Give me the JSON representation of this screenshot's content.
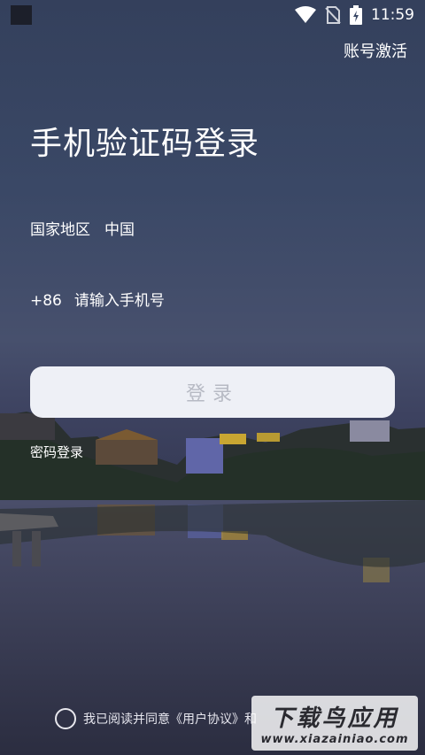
{
  "status_bar": {
    "time": "11:59",
    "icons": [
      "wifi-icon",
      "no-sim-icon",
      "battery-charging-icon"
    ]
  },
  "header": {
    "activate_label": "账号激活"
  },
  "title": "手机验证码登录",
  "region": {
    "label": "国家地区",
    "value": "中国"
  },
  "phone": {
    "country_code": "+86",
    "placeholder": "请输入手机号"
  },
  "login_button": "登录",
  "password_login_label": "密码登录",
  "agreement": {
    "text": "我已阅读并同意《用户协议》和"
  },
  "watermark": {
    "brand": "下载鸟应用",
    "url": "www.xiazainiao.com"
  },
  "colors": {
    "button_bg": "#eef0f6",
    "button_text": "#b7bac4"
  }
}
